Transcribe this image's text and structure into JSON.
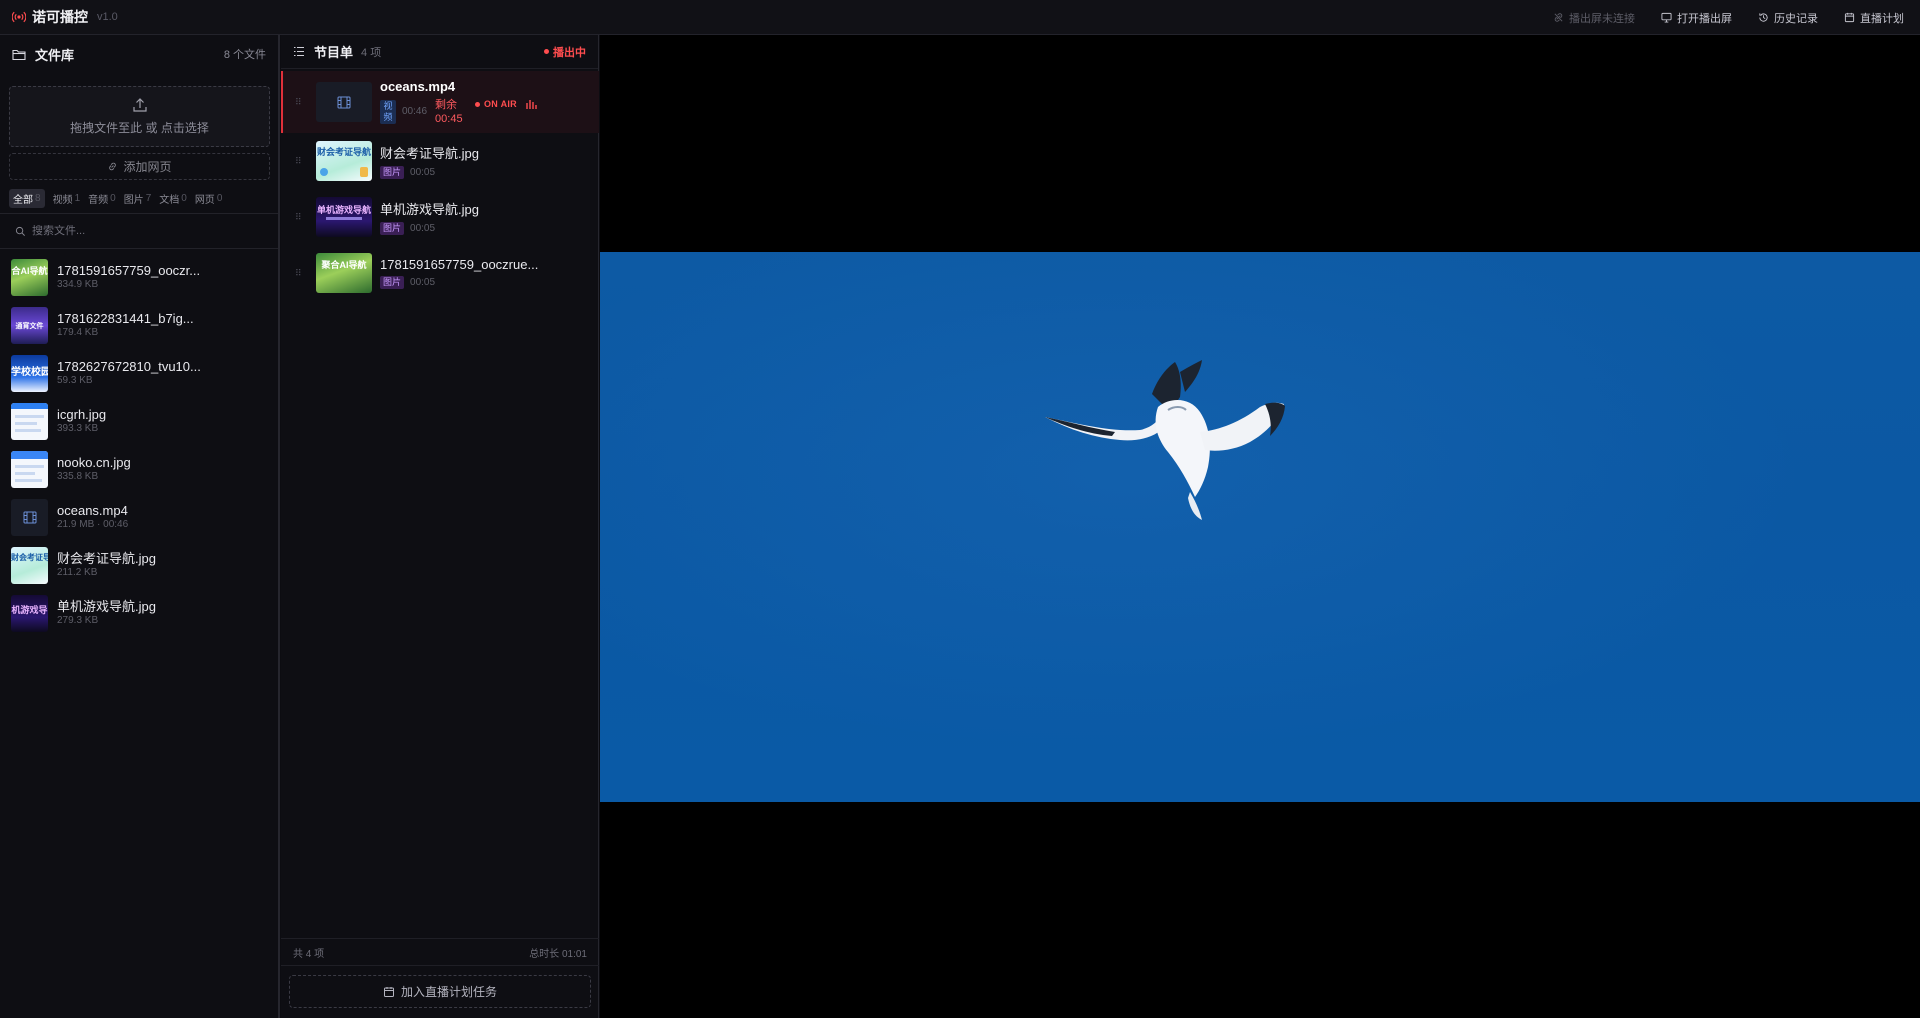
{
  "app": {
    "title": "诺可播控",
    "version": "v1.0"
  },
  "topbar": {
    "actions": [
      {
        "label": "播出屏未连接",
        "icon": "link-off-icon",
        "disabled": true
      },
      {
        "label": "打开播出屏",
        "icon": "monitor-icon"
      },
      {
        "label": "历史记录",
        "icon": "history-icon"
      },
      {
        "label": "直播计划",
        "icon": "calendar-icon"
      }
    ]
  },
  "library": {
    "title": "文件库",
    "count": "8 个文件",
    "drop_text": "拖拽文件至此 或 点击选择",
    "add_web": "添加网页",
    "tabs": [
      {
        "label": "全部",
        "count": "8"
      },
      {
        "label": "视频",
        "count": "1"
      },
      {
        "label": "音频",
        "count": "0"
      },
      {
        "label": "图片",
        "count": "7"
      },
      {
        "label": "文档",
        "count": "0"
      },
      {
        "label": "网页",
        "count": "0"
      }
    ],
    "search_placeholder": "搜索文件...",
    "files": [
      {
        "name": "1781591657759_ooczr...",
        "meta": "334.9 KB",
        "thumb": "green",
        "thumb_text": "合AI导航"
      },
      {
        "name": "1781622831441_b7ig...",
        "meta": "179.4 KB",
        "thumb": "purple",
        "thumb_text": "通宵文件"
      },
      {
        "name": "1782627672810_tvu10...",
        "meta": "59.3 KB",
        "thumb": "blue",
        "thumb_text": "学校校园"
      },
      {
        "name": "icgrh.jpg",
        "meta": "393.3 KB",
        "thumb": "white",
        "thumb_text": ""
      },
      {
        "name": "nooko.cn.jpg",
        "meta": "335.8 KB",
        "thumb": "white",
        "thumb_text": ""
      },
      {
        "name": "oceans.mp4",
        "meta": "21.9 MB · 00:46",
        "thumb": "film",
        "thumb_text": ""
      },
      {
        "name": "财会考证导航.jpg",
        "meta": "211.2 KB",
        "thumb": "mint",
        "thumb_text": "财会考证导"
      },
      {
        "name": "单机游戏导航.jpg",
        "meta": "279.3 KB",
        "thumb": "dark",
        "thumb_text": "机游戏导"
      }
    ]
  },
  "playlist": {
    "title": "节目单",
    "count": "4 项",
    "live_status": "播出中",
    "items": [
      {
        "name": "oceans.mp4",
        "type": "视频",
        "duration": "00:46",
        "remain_label": "剩余",
        "remain_time": "00:45",
        "on_air": "ON AIR",
        "thumb": "film"
      },
      {
        "name": "财会考证导航.jpg",
        "type": "图片",
        "duration": "00:05",
        "thumb": "mint",
        "thumb_text": "财会考证导航"
      },
      {
        "name": "单机游戏导航.jpg",
        "type": "图片",
        "duration": "00:05",
        "thumb": "dark",
        "thumb_text": "单机游戏导航"
      },
      {
        "name": "1781591657759_ooczrue...",
        "type": "图片",
        "duration": "00:05",
        "thumb": "green",
        "thumb_text": "聚合AI导航"
      }
    ],
    "footer_count": "共 4 项",
    "footer_total": "总时长 01:01",
    "schedule_button": "加入直播计划任务"
  },
  "colors": {
    "accent_red": "#ff4d4f",
    "video_blue": "#0b58a3",
    "panel_bg": "#0e0e13"
  }
}
